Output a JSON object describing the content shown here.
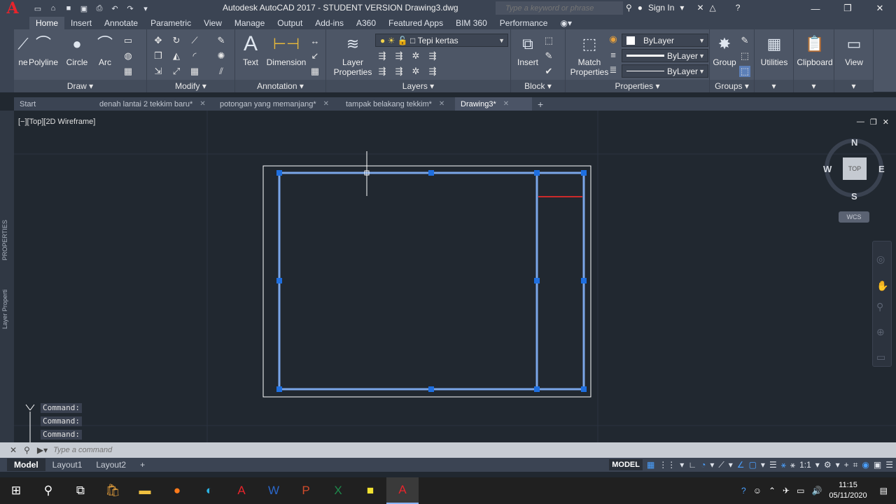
{
  "title_bar": {
    "title": "Autodesk AutoCAD 2017 - STUDENT VERSION    Drawing3.dwg",
    "search_placeholder": "Type a keyword or phrase",
    "sign_in": "Sign In"
  },
  "ribbon_tabs": [
    "Home",
    "Insert",
    "Annotate",
    "Parametric",
    "View",
    "Manage",
    "Output",
    "Add-ins",
    "A360",
    "Featured Apps",
    "BIM 360",
    "Performance"
  ],
  "ribbon": {
    "draw": {
      "title": "Draw",
      "line": "ne",
      "polyline": "Polyline",
      "circle": "Circle",
      "arc": "Arc"
    },
    "modify": {
      "title": "Modify"
    },
    "annotation": {
      "title": "Annotation",
      "text": "Text",
      "dimension": "Dimension"
    },
    "layers": {
      "title": "Layers",
      "layer_properties": "Layer Properties",
      "current_layer": "Tepi kertas"
    },
    "block": {
      "title": "Block",
      "insert": "Insert"
    },
    "properties": {
      "title": "Properties",
      "match": "Match Properties",
      "color": "ByLayer",
      "linetype": "ByLayer",
      "lineweight": "ByLayer"
    },
    "groups": {
      "title": "Groups",
      "group": "Group"
    },
    "utilities": "Utilities",
    "clipboard": "Clipboard",
    "view": "View"
  },
  "doc_tabs": [
    {
      "label": "Start"
    },
    {
      "label": "denah lantai 2 tekkim baru*"
    },
    {
      "label": "potongan yang memanjang*"
    },
    {
      "label": "tampak belakang tekkim*"
    },
    {
      "label": "Drawing3*"
    }
  ],
  "viewport": {
    "label": "[−][Top][2D Wireframe]",
    "viewcube": {
      "n": "N",
      "s": "S",
      "e": "E",
      "w": "W",
      "top": "TOP",
      "wcs": "WCS"
    },
    "side_labels": [
      "PROPERTIES",
      "Layer Properti"
    ]
  },
  "command_history": [
    "Command:",
    "Command:",
    "Command:"
  ],
  "command_placeholder": "Type a command",
  "layout_tabs": [
    "Model",
    "Layout1",
    "Layout2"
  ],
  "status": {
    "model": "MODEL",
    "scale": "1:1"
  },
  "clock": {
    "time": "11:15",
    "date": "05/11/2020"
  },
  "colors": {
    "accent": "#e8242b",
    "selection": "#5b8fd6",
    "grip": "#1e6fe0",
    "red_line": "#cc2a2a"
  }
}
